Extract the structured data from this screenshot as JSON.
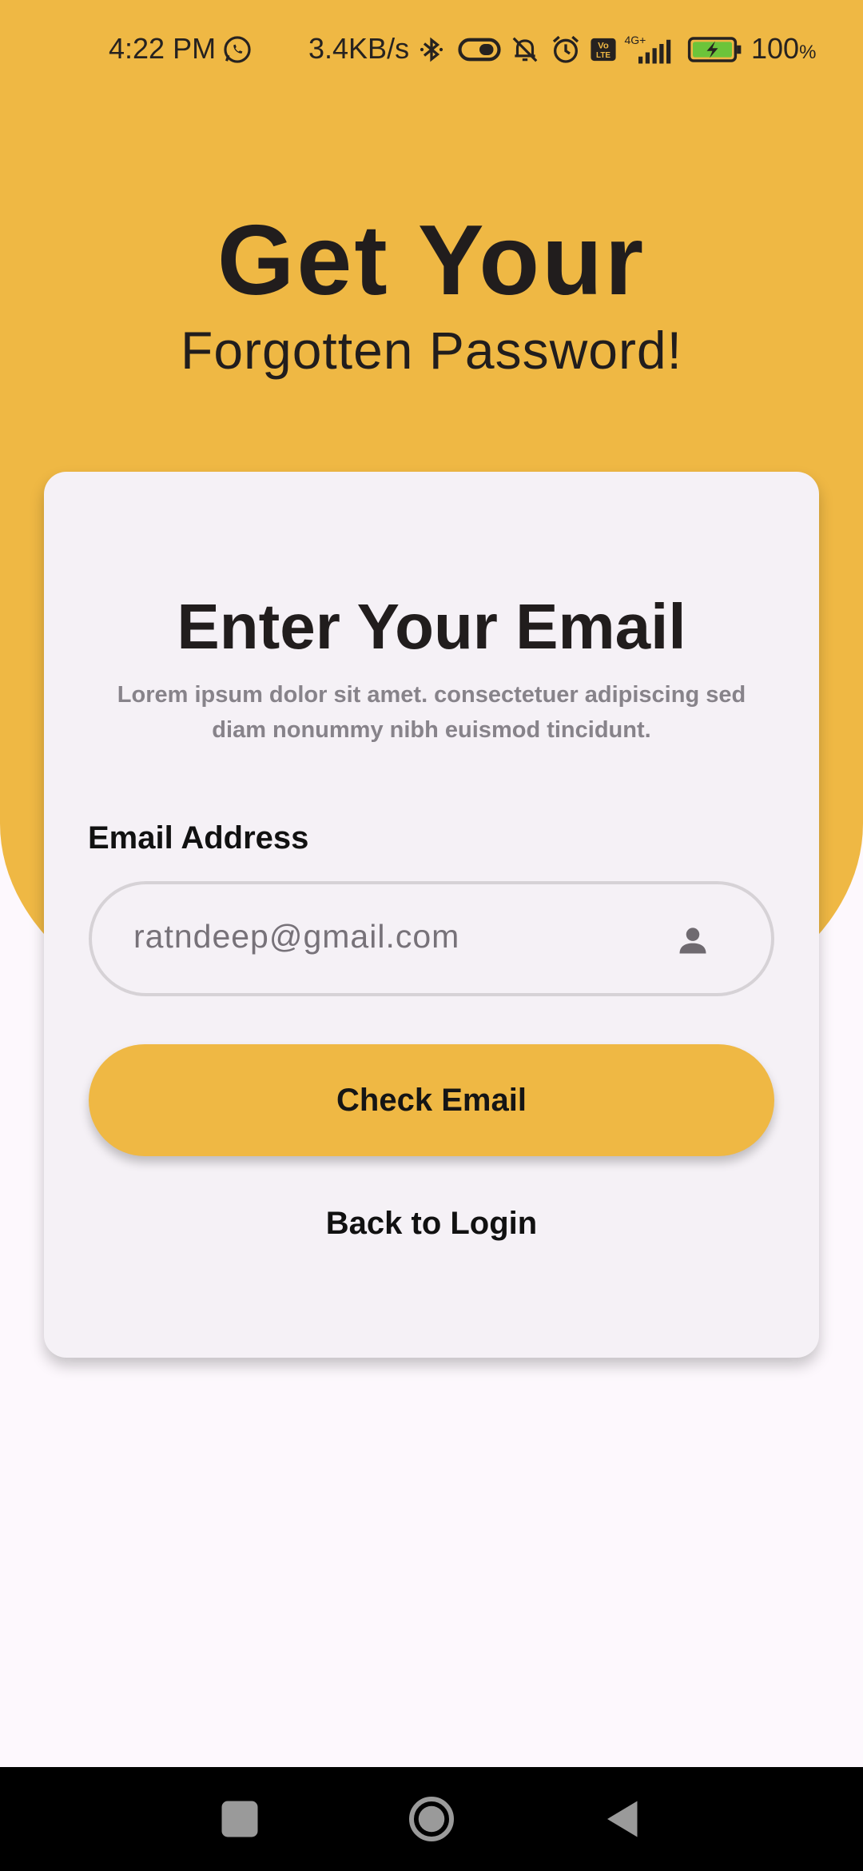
{
  "status_bar": {
    "time": "4:22 PM",
    "net_speed": "3.4KB/s",
    "battery_percent": "100",
    "battery_unit": "%",
    "icons": [
      "whatsapp-icon",
      "bluetooth-icon",
      "toggle-icon",
      "bell-muted-icon",
      "alarm-icon",
      "volte-icon",
      "signal-4g-icon",
      "battery-charging-icon"
    ],
    "volte_label": "Vo LTE",
    "network_label": "4G+"
  },
  "hero": {
    "title": "Get Your",
    "subtitle": "Forgotten Password!"
  },
  "card": {
    "title": "Enter Your Email",
    "description": "Lorem ipsum dolor sit amet. consectetuer adipiscing sed diam nonummy nibh euismod tincidunt.",
    "email_label": "Email Address",
    "email_value": "ratndeep@gmail.com",
    "check_button": "Check Email",
    "back_link": "Back to Login"
  },
  "nav_bar": {
    "buttons": [
      "recents-button",
      "home-button",
      "back-button"
    ]
  },
  "colors": {
    "accent": "#efb844",
    "background": "#fdf8fd",
    "card": "#f5f1f6",
    "text": "#211d1d",
    "muted": "#87838a"
  }
}
